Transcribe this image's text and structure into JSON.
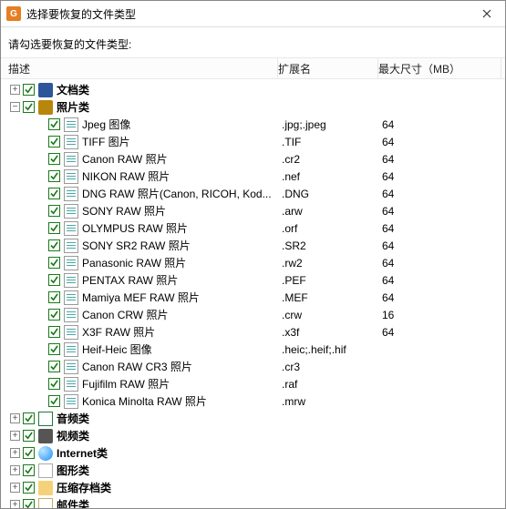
{
  "title": "选择要恢复的文件类型",
  "close_glyph": "✕",
  "instruction": "请勾选要恢复的文件类型:",
  "headers": {
    "desc": "描述",
    "ext": "扩展名",
    "size": "最大尺寸（MB）"
  },
  "categories": [
    {
      "key": "docs",
      "label": "文档类",
      "expanded": false,
      "iconClass": "square doc-cat"
    },
    {
      "key": "photos",
      "label": "照片类",
      "expanded": true,
      "iconClass": "square pic-cat"
    },
    {
      "key": "audio",
      "label": "音频类",
      "expanded": false,
      "iconClass": "note aud-cat"
    },
    {
      "key": "video",
      "label": "视频类",
      "expanded": false,
      "iconClass": "square vid-cat"
    },
    {
      "key": "inet",
      "label": "Internet类",
      "expanded": false,
      "iconClass": "globe"
    },
    {
      "key": "gfx",
      "label": "图形类",
      "expanded": false,
      "iconClass": "brush"
    },
    {
      "key": "arc",
      "label": "压缩存档类",
      "expanded": false,
      "iconClass": "folder arc-cat"
    },
    {
      "key": "mail",
      "label": "邮件类",
      "expanded": false,
      "iconClass": "env mail-cat"
    }
  ],
  "photos_children": [
    {
      "label": "Jpeg 图像",
      "ext": ".jpg;.jpeg",
      "size": "64"
    },
    {
      "label": "TIFF 图片",
      "ext": ".TIF",
      "size": "64"
    },
    {
      "label": "Canon RAW 照片",
      "ext": ".cr2",
      "size": "64"
    },
    {
      "label": "NIKON RAW 照片",
      "ext": ".nef",
      "size": "64"
    },
    {
      "label": "DNG RAW 照片(Canon, RICOH, Kod...",
      "ext": ".DNG",
      "size": "64"
    },
    {
      "label": "SONY RAW 照片",
      "ext": ".arw",
      "size": "64"
    },
    {
      "label": "OLYMPUS RAW 照片",
      "ext": ".orf",
      "size": "64"
    },
    {
      "label": "SONY SR2 RAW 照片",
      "ext": ".SR2",
      "size": "64"
    },
    {
      "label": "Panasonic RAW 照片",
      "ext": ".rw2",
      "size": "64"
    },
    {
      "label": "PENTAX RAW 照片",
      "ext": ".PEF",
      "size": "64"
    },
    {
      "label": "Mamiya MEF RAW 照片",
      "ext": ".MEF",
      "size": "64"
    },
    {
      "label": "Canon CRW 照片",
      "ext": ".crw",
      "size": "16"
    },
    {
      "label": "X3F RAW 照片",
      "ext": ".x3f",
      "size": "64"
    },
    {
      "label": "Heif-Heic 图像",
      "ext": ".heic;.heif;.hif",
      "size": ""
    },
    {
      "label": "Canon RAW CR3 照片",
      "ext": ".cr3",
      "size": ""
    },
    {
      "label": "Fujifilm RAW 照片",
      "ext": ".raf",
      "size": ""
    },
    {
      "label": "Konica Minolta RAW 照片",
      "ext": ".mrw",
      "size": ""
    }
  ]
}
